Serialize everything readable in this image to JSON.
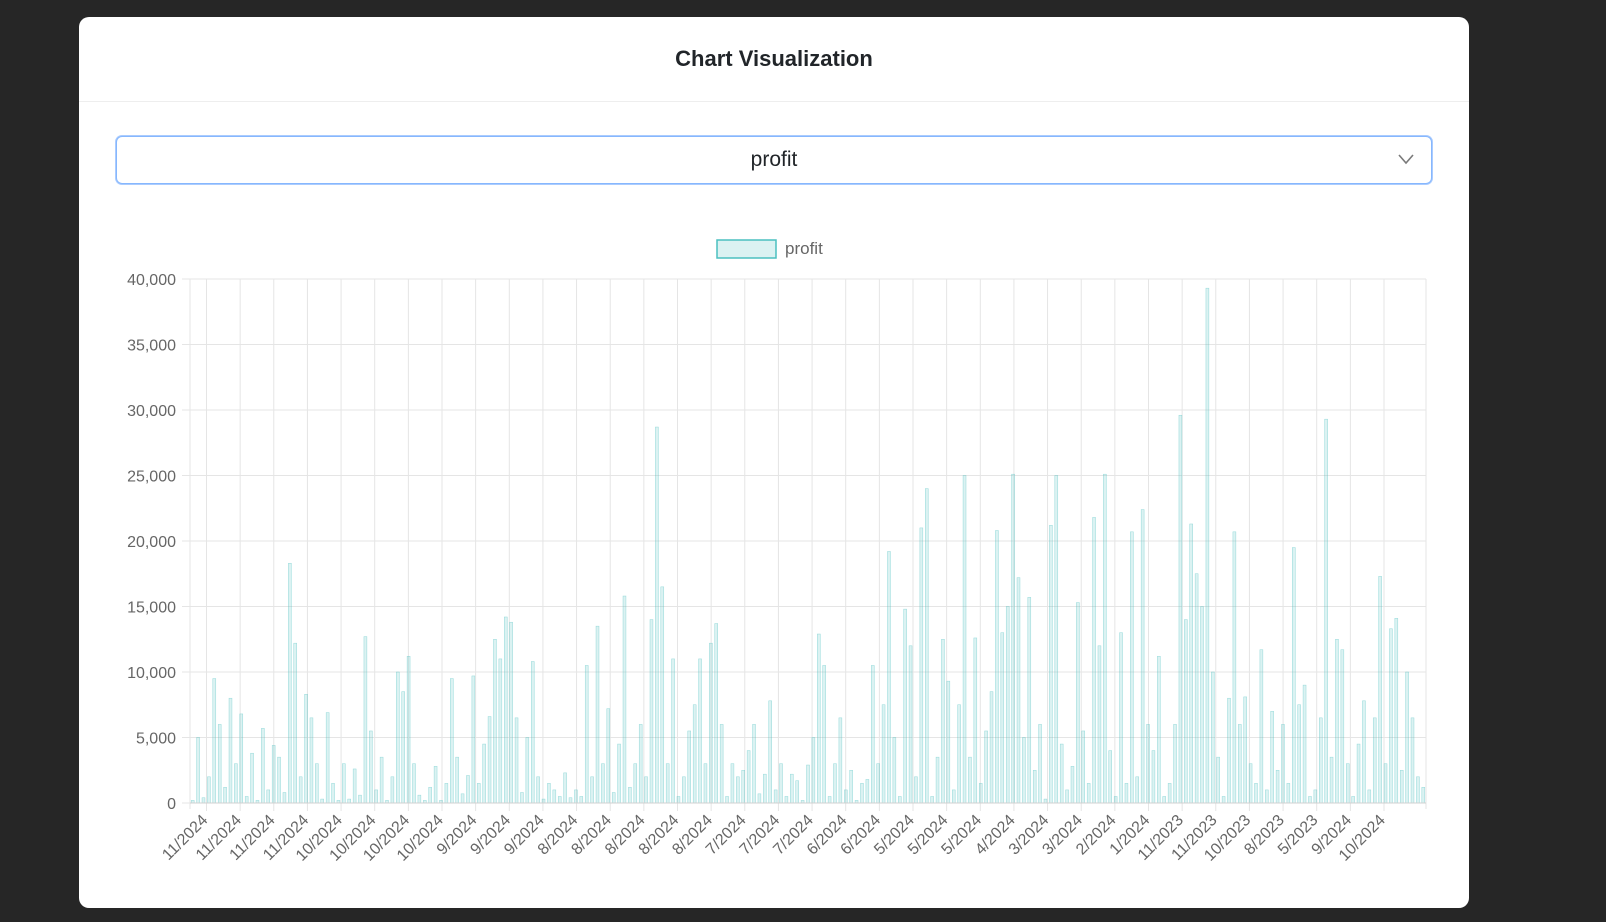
{
  "modal": {
    "title": "Chart Visualization"
  },
  "select": {
    "selected": "profit"
  },
  "colors": {
    "bar_fill": "rgba(75,192,192,0.2)",
    "bar_stroke": "rgba(75,192,192,1)",
    "grid": "#e5e5e5",
    "text": "#666666"
  },
  "chart_data": {
    "type": "bar",
    "legend": {
      "label": "profit",
      "position": "top"
    },
    "ylim": [
      0,
      40000
    ],
    "yticks": [
      0,
      5000,
      10000,
      15000,
      20000,
      25000,
      30000,
      35000,
      40000
    ],
    "grid": true,
    "xtick_labels": [
      "11/2024",
      "11/2024",
      "11/2024",
      "11/2024",
      "10/2024",
      "10/2024",
      "10/2024",
      "10/2024",
      "9/2024",
      "9/2024",
      "9/2024",
      "8/2024",
      "8/2024",
      "8/2024",
      "8/2024",
      "8/2024",
      "7/2024",
      "7/2024",
      "7/2024",
      "6/2024",
      "6/2024",
      "5/2024",
      "5/2024",
      "5/2024",
      "4/2024",
      "3/2024",
      "3/2024",
      "2/2024",
      "1/2024",
      "11/2023",
      "11/2023",
      "10/2023",
      "8/2023",
      "5/2023",
      "9/2024",
      "10/2024"
    ],
    "series": [
      {
        "name": "profit",
        "values": [
          200,
          5000,
          400,
          2000,
          9500,
          6000,
          1200,
          8000,
          3000,
          6800,
          500,
          3800,
          200,
          5700,
          1000,
          4400,
          3500,
          800,
          18300,
          12200,
          2000,
          8300,
          6500,
          3000,
          300,
          6900,
          1500,
          200,
          3000,
          300,
          2600,
          600,
          12700,
          5500,
          1000,
          3500,
          200,
          2000,
          10000,
          8500,
          11200,
          3000,
          600,
          200,
          1200,
          2800,
          200,
          1500,
          9500,
          3500,
          700,
          2100,
          9700,
          1500,
          4500,
          6600,
          12500,
          11000,
          14200,
          13800,
          6500,
          800,
          5000,
          10800,
          2000,
          300,
          1500,
          1000,
          500,
          2300,
          400,
          1000,
          500,
          10500,
          2000,
          13500,
          3000,
          7200,
          800,
          4500,
          15800,
          1200,
          3000,
          6000,
          2000,
          14000,
          28700,
          16500,
          3000,
          11000,
          500,
          2000,
          5500,
          7500,
          11000,
          3000,
          12200,
          13700,
          6000,
          500,
          3000,
          2000,
          2500,
          4000,
          6000,
          700,
          2200,
          7800,
          1000,
          3000,
          500,
          2200,
          1700,
          200,
          2900,
          5000,
          12900,
          10500,
          500,
          3000,
          6500,
          1000,
          2500,
          200,
          1500,
          1800,
          10500,
          3000,
          7500,
          19200,
          5000,
          500,
          14800,
          12000,
          2000,
          21000,
          24000,
          500,
          3500,
          12500,
          9300,
          1000,
          7500,
          25000,
          3500,
          12600,
          1500,
          5500,
          8500,
          20800,
          13000,
          15000,
          25100,
          17200,
          5000,
          15700,
          2500,
          6000,
          300,
          21200,
          25000,
          4500,
          1000,
          2800,
          15300,
          5500,
          1500,
          21800,
          12000,
          25100,
          4000,
          500,
          13000,
          1500,
          20700,
          2000,
          22400,
          6000,
          4000,
          11200,
          500,
          1500,
          6000,
          29600,
          14000,
          21300,
          17500,
          15000,
          39300,
          10000,
          3500,
          500,
          8000,
          20700,
          6000,
          8100,
          3000,
          1500,
          11700,
          1000,
          7000,
          2500,
          6000,
          1500,
          19500,
          7500,
          9000,
          500,
          1000,
          6500,
          29300,
          3500,
          12500,
          11700,
          3000,
          500,
          4500,
          7800,
          1000,
          6500,
          17300,
          3000,
          13300,
          14100,
          2500,
          10000,
          6500,
          2000,
          1200
        ],
        "values_note_removed": true
      }
    ]
  }
}
